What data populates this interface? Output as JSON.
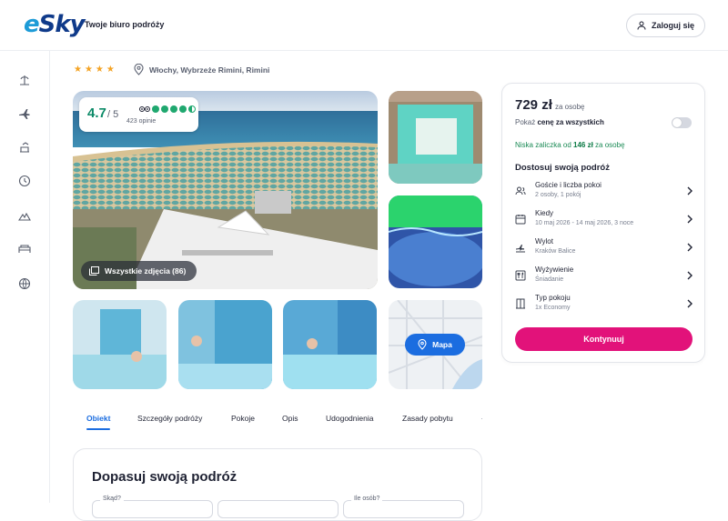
{
  "header": {
    "logo_e": "e",
    "logo_sky": "Sky",
    "tagline": "Twoje biuro podróży",
    "login_label": "Zaloguj się"
  },
  "sidebar": {
    "icons": [
      "beach-icon",
      "flight-icon",
      "flight-hotel-icon",
      "last-minute-icon",
      "mountain-icon",
      "hotel-bed-icon",
      "globe-icon"
    ]
  },
  "hotel": {
    "stars": "★★★★",
    "location": "Włochy, Wybrzeże Rimini, Rimini",
    "rating": "4.7",
    "rating_of": "/ 5",
    "rating_dots_filled": 4.5,
    "opinions": "423 opinie",
    "all_photos_label": "Wszystkie zdjęcia (86)",
    "map_label": "Mapa"
  },
  "tabs": [
    {
      "label": "Obiekt",
      "active": true
    },
    {
      "label": "Szczegóły podróży"
    },
    {
      "label": "Pokoje"
    },
    {
      "label": "Opis"
    },
    {
      "label": "Udogodnienia"
    },
    {
      "label": "Zasady pobytu"
    }
  ],
  "bottom": {
    "title": "Dopasuj swoją podróż",
    "field_from": "Skąd?",
    "field_people": "Ile osób?"
  },
  "booking": {
    "price": "729 zł",
    "price_per": "za osobę",
    "show_total_prefix": "Pokaż ",
    "show_total_bold": "cenę za wszystkich",
    "deposit_prefix": "Niska zaliczka od ",
    "deposit_amount": "146 zł",
    "deposit_suffix": " za osobę",
    "customize_title": "Dostosuj swoją podróż",
    "options": [
      {
        "title": "Goście i liczba pokoi",
        "sub": "2 osoby, 1 pokój",
        "icon": "guests-icon"
      },
      {
        "title": "Kiedy",
        "sub": "10 maj 2026 - 14 maj 2026, 3 noce",
        "icon": "calendar-icon"
      },
      {
        "title": "Wylot",
        "sub": "Kraków Balice",
        "icon": "departure-icon"
      },
      {
        "title": "Wyżywienie",
        "sub": "Śniadanie",
        "icon": "meal-icon"
      },
      {
        "title": "Typ pokoju",
        "sub": "1x Economy",
        "icon": "room-icon"
      }
    ],
    "cta_label": "Kontynuuj"
  },
  "colors": {
    "brand_blue": "#1b6de0",
    "cta_pink": "#e2127a",
    "rating_green": "#1fa86f",
    "star_orange": "#f4a324"
  }
}
